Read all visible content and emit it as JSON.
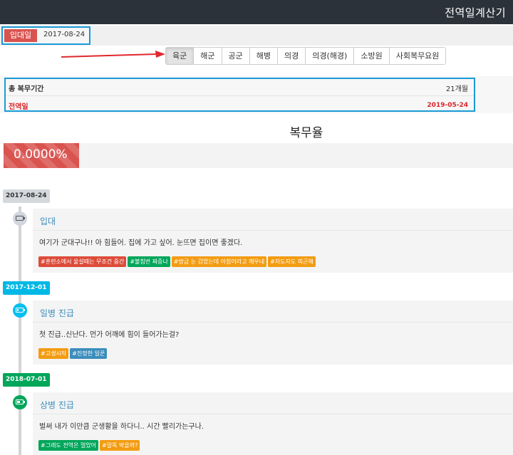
{
  "app": {
    "title": "전역일계산기"
  },
  "join": {
    "label": "입대일",
    "date": "2017-08-24"
  },
  "branches": {
    "items": [
      "육군",
      "해군",
      "공군",
      "해병",
      "의경",
      "의경(해경)",
      "소방원",
      "사회복무요원"
    ],
    "selected": "육군"
  },
  "summary": {
    "total_label": "총 복무기간",
    "total_value": "21개월",
    "discharge_label": "전역일",
    "discharge_value": "2019-05-24"
  },
  "rate": {
    "title": "복무율",
    "text": "0.0000%",
    "percent": 0.0,
    "bar_color": "#d9534f"
  },
  "timeline": [
    {
      "date": "2017-08-24",
      "title": "입대",
      "body": "여기가 군대구나!! 아 힘들어. 집에 가고 싶어. 눈뜨면 집이면 좋겠다.",
      "icon": "battery-empty-icon",
      "battery_level": 0.0,
      "tags": [
        {
          "text": "#훈련소에서 울설때는 무조건 중간",
          "color": "#dd4b39"
        },
        {
          "text": "#불침번 짜증나",
          "color": "#00a65a"
        },
        {
          "text": "#방금 눈 감았는데 아침이라고 깨우네",
          "color": "#f39c12"
        },
        {
          "text": "#자도자도 피곤해",
          "color": "#f39c12"
        }
      ]
    },
    {
      "date": "2017-12-01",
      "title": "일병 진급",
      "body": "첫 진급..신난다. 먼가 어깨에 힘이 들어가는걸?",
      "icon": "battery-quarter-icon",
      "battery_level": 0.3,
      "tags": [
        {
          "text": "#고생시작",
          "color": "#f39c12"
        },
        {
          "text": "#진정한 일꾼",
          "color": "#3c8dbc"
        }
      ]
    },
    {
      "date": "2018-07-01",
      "title": "상병 진급",
      "body": "벌써 내가 이만큼 군생활을 하다니.. 시간 빨리가는구나.",
      "icon": "battery-half-icon",
      "battery_level": 0.6,
      "tags": [
        {
          "text": "#그래도 전역은 멀었어",
          "color": "#00a65a"
        },
        {
          "text": "#말뚝 박을까?",
          "color": "#f39c12"
        }
      ]
    }
  ],
  "colors": {
    "topbar": "#2b3239",
    "accent_blue": "#1a9ad6",
    "danger": "#d9534f",
    "link": "#3c8dbc",
    "annotation_arrow": "#e0282e"
  }
}
